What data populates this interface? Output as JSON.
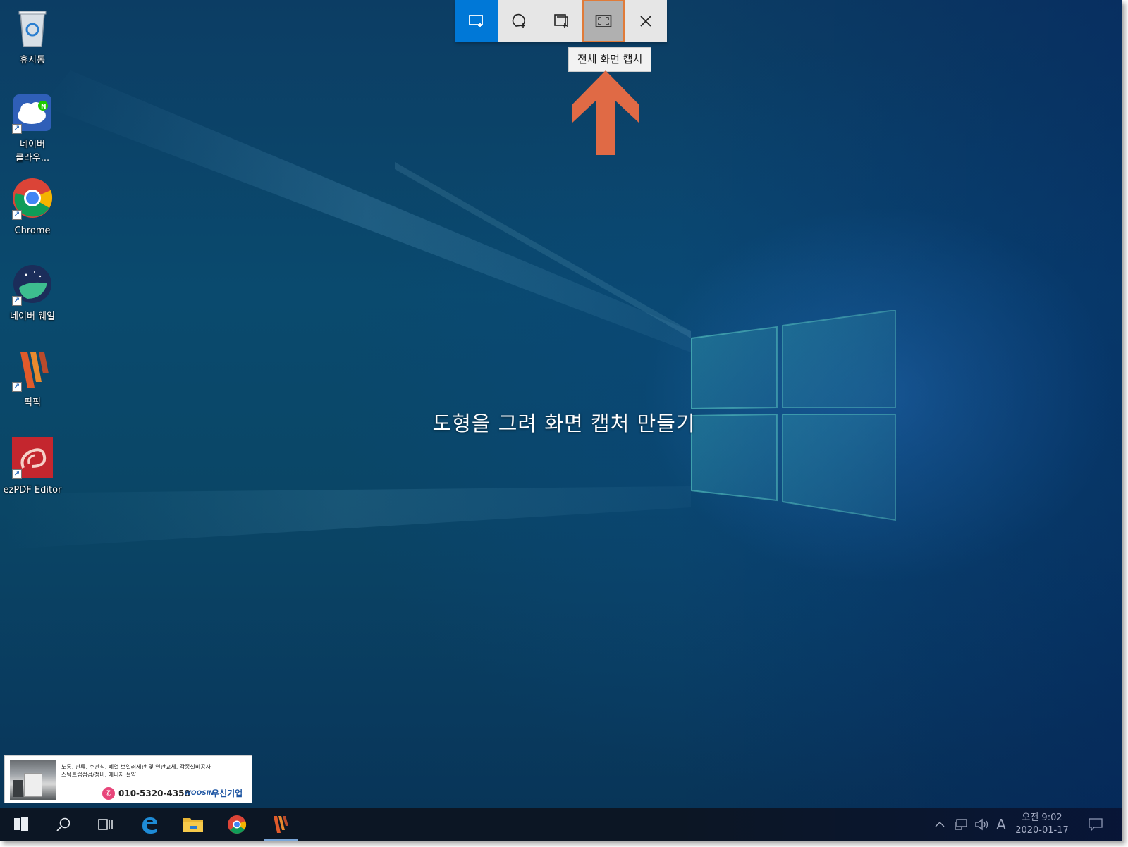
{
  "desktop": {
    "icons": [
      {
        "name": "recycle-bin",
        "label": "휴지통"
      },
      {
        "name": "naver-cloud",
        "label": "네이버\n클라우..."
      },
      {
        "name": "chrome",
        "label": "Chrome"
      },
      {
        "name": "naver-whale",
        "label": "네이버 웨일"
      },
      {
        "name": "picpick",
        "label": "픽픽"
      },
      {
        "name": "ezpdf-editor",
        "label": "ezPDF Editor"
      }
    ]
  },
  "snip_toolbar": {
    "buttons": [
      {
        "name": "rectangular-snip-icon",
        "state": "selected"
      },
      {
        "name": "freeform-snip-icon",
        "state": "normal"
      },
      {
        "name": "window-snip-icon",
        "state": "normal"
      },
      {
        "name": "fullscreen-snip-icon",
        "state": "hover"
      },
      {
        "name": "close-icon",
        "state": "normal"
      }
    ],
    "tooltip": "전체 화면 캡처",
    "selected_color": "#0078d7"
  },
  "annotation": {
    "arrow_color": "#e06a45"
  },
  "center_prompt": "도형을 그려 화면 캡처 만들기",
  "ad_banner": {
    "text": "노통, 관류, 수관식, 폐열 보일러세관 및 연관교체, 각종설비공사\n스팀트랩점검/정비, 에너지 절약!",
    "phone": "010-5320-4358",
    "brand_en": "WOOSIN",
    "brand_ko": "우신기업"
  },
  "taskbar": {
    "items": [
      "start-icon",
      "search-icon",
      "task-view-icon",
      "edge-icon",
      "file-explorer-icon",
      "chrome-icon",
      "picpick-icon"
    ],
    "tray_icons": [
      "chevron-up-icon",
      "network-icon",
      "volume-icon",
      "input-method-icon",
      "notification-icon"
    ],
    "ime_label": "A",
    "clock_time": "오전 9:02",
    "clock_date": "2020-01-17"
  }
}
